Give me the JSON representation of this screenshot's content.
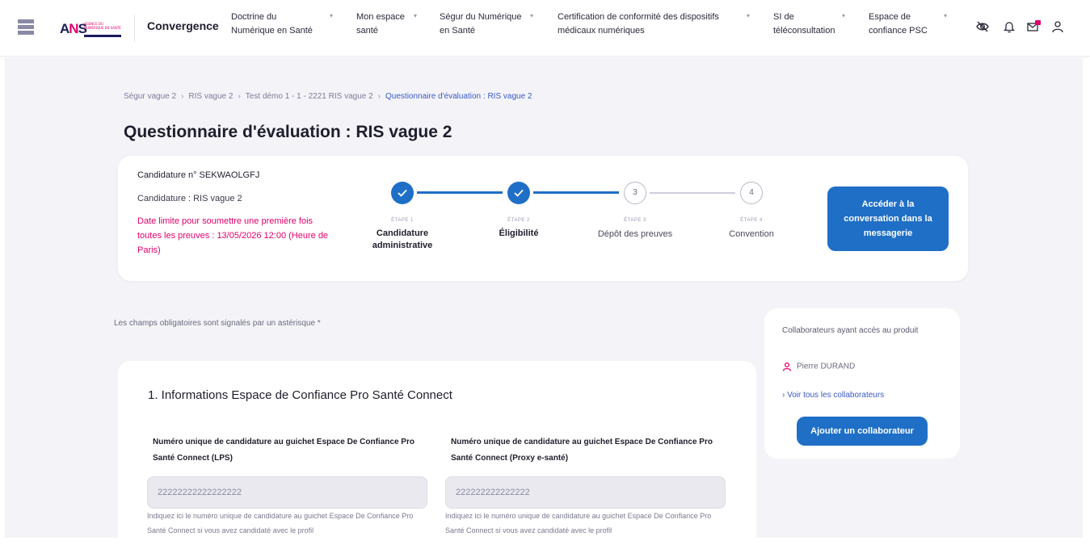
{
  "header": {
    "brand": "Convergence",
    "logo_text": "ANS",
    "logo_sub": "AGENCE DU NUMÉRIQUE EN SANTÉ",
    "nav": [
      {
        "label_line1": "Doctrine du",
        "label_line2": "Numérique en Santé"
      },
      {
        "label_line1": "Mon espace",
        "label_line2": "santé"
      },
      {
        "label_line1": "Ségur du Numérique",
        "label_line2": "en Santé"
      },
      {
        "label_line1": "Certification de conformité des dispositifs",
        "label_line2": "médicaux numériques"
      },
      {
        "label_line1": "SI de",
        "label_line2": "téléconsultation"
      },
      {
        "label_line1": "Espace de",
        "label_line2": "confiance PSC"
      }
    ],
    "icons": [
      "eye-off-icon",
      "bell-icon",
      "mail-icon",
      "user-icon"
    ],
    "notification_color": "#e2006a"
  },
  "breadcrumb": {
    "items": [
      "Ségur vague 2",
      "RIS vague 2",
      "Test démo 1 - 1 - 2221 RIS vague 2",
      "Questionnaire d'évaluation : RIS vague 2"
    ],
    "separator": "›"
  },
  "page": {
    "title": "Questionnaire d'évaluation : RIS vague 2",
    "required_note": "Les champs obligatoires sont signalés par un astérisque *"
  },
  "status": {
    "candidature_number": "Candidature n° SEKWAOLGFJ",
    "candidature_type": "Candidature : RIS vague 2",
    "deadline": "Date limite pour soumettre une première fois toutes les preuves : 13/05/2026 12:00 (Heure de Paris)",
    "steps": [
      {
        "kicker": "ÉTAPE 1",
        "label": "Candidature administrative",
        "state": "done",
        "number": "1"
      },
      {
        "kicker": "ÉTAPE 2",
        "label": "Éligibilité",
        "state": "done",
        "number": "2"
      },
      {
        "kicker": "ÉTAPE 3",
        "label": "Dépôt des preuves",
        "state": "todo",
        "number": "3"
      },
      {
        "kicker": "ÉTAPE 4",
        "label": "Convention",
        "state": "todo",
        "number": "4"
      }
    ],
    "conversation_button": "Accéder à la conversation dans la messagerie"
  },
  "collaborators": {
    "title": "Collaborateurs ayant accès au produit",
    "person": "Pierre DURAND",
    "see_all_link": "Voir tous les collaborateurs",
    "add_button": "Ajouter un collaborateur"
  },
  "form": {
    "section_title": "1. Informations Espace de Confiance Pro Santé Connect",
    "fields": [
      {
        "label": "Numéro unique de candidature au guichet Espace De Confiance Pro Santé Connect (LPS)",
        "value": "22222222222222222",
        "help": "Indiquez ici le numéro unique de candidature au guichet Espace De Confiance Pro Santé Connect si vous avez candidaté avec le profil"
      },
      {
        "label": "Numéro unique de candidature au guichet Espace De Confiance Pro Santé Connect (Proxy e-santé)",
        "value": "222222222222222",
        "help": "Indiquez ici le numéro unique de candidature au guichet Espace De Confiance Pro Santé Connect si vous avez candidaté avec le profil"
      }
    ]
  },
  "colors": {
    "primary": "#1f6fc6",
    "accent": "#e2006a",
    "link": "#3b59c7"
  }
}
